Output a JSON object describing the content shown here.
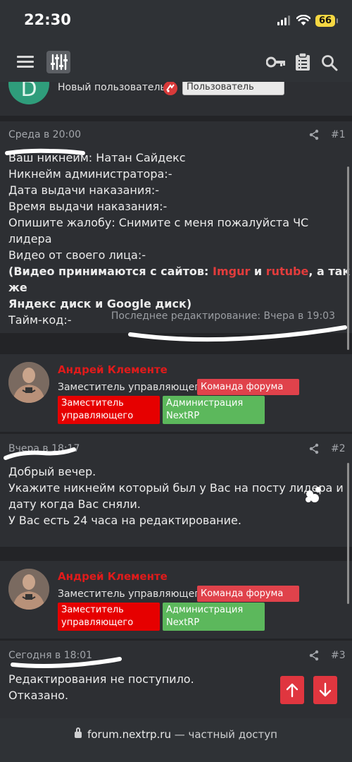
{
  "status": {
    "time": "22:30",
    "battery": "66"
  },
  "header": {
    "menu_icon": "hamburger-icon",
    "logo_icon": "sliders-icon",
    "icons": [
      "key-icon",
      "clipboard-icon",
      "search-icon"
    ]
  },
  "top_author": {
    "avatar_letter": "D",
    "title": "Новый пользователь",
    "badge": "Пользователь"
  },
  "posts": [
    {
      "date": "Среда в 20:00",
      "num": "#1",
      "lines": [
        "Ваш никнейм: Натан Сайдекс",
        "Никнейм администратора:-",
        "Дата выдачи наказания:-",
        "Время выдачи наказания:-",
        "Опишите жалобу: Снимите с меня пожалуйста ЧС лидера",
        "Видео от своего лица:-"
      ],
      "video_note": {
        "p1": "(Видео принимаются с сайтов: ",
        "imgur": "Imgur",
        "p2": " и ",
        "rutube": "rutube",
        "p3": ", а так же",
        "p4": "Яндекс диск и Google диск)"
      },
      "last_line": "Тайм-код:-",
      "edited": "Последнее редактирование: Вчера в 19:03"
    },
    {
      "date": "Вчера в 18:17",
      "num": "#2",
      "lines": [
        "Добрый вечер.",
        "Укажите никнейм который был у Вас на посту лидера и",
        "дату когда Вас сняли.",
        "У Вас есть 24 часа на редактирование."
      ]
    },
    {
      "date": "Сегодня в 18:01",
      "num": "#3",
      "lines": [
        "Редактирования не поступило.",
        "Отказано."
      ]
    }
  ],
  "author": {
    "name": "Андрей Клементе",
    "title": "Заместитель управляющего",
    "forum_badge": "Команда форума",
    "badge_red_l1": "Заместитель",
    "badge_red_l2": "управляющего",
    "badge_green_l1": "Администрация",
    "badge_green_l2": "NextRP"
  },
  "url": {
    "host": "forum.nextrp.ru",
    "suffix": " — частный доступ"
  },
  "colors": {
    "accent_red": "#e23c3c",
    "badge_red": "#e60000",
    "badge_green": "#5cb85c",
    "forum_badge": "#e0424b"
  }
}
